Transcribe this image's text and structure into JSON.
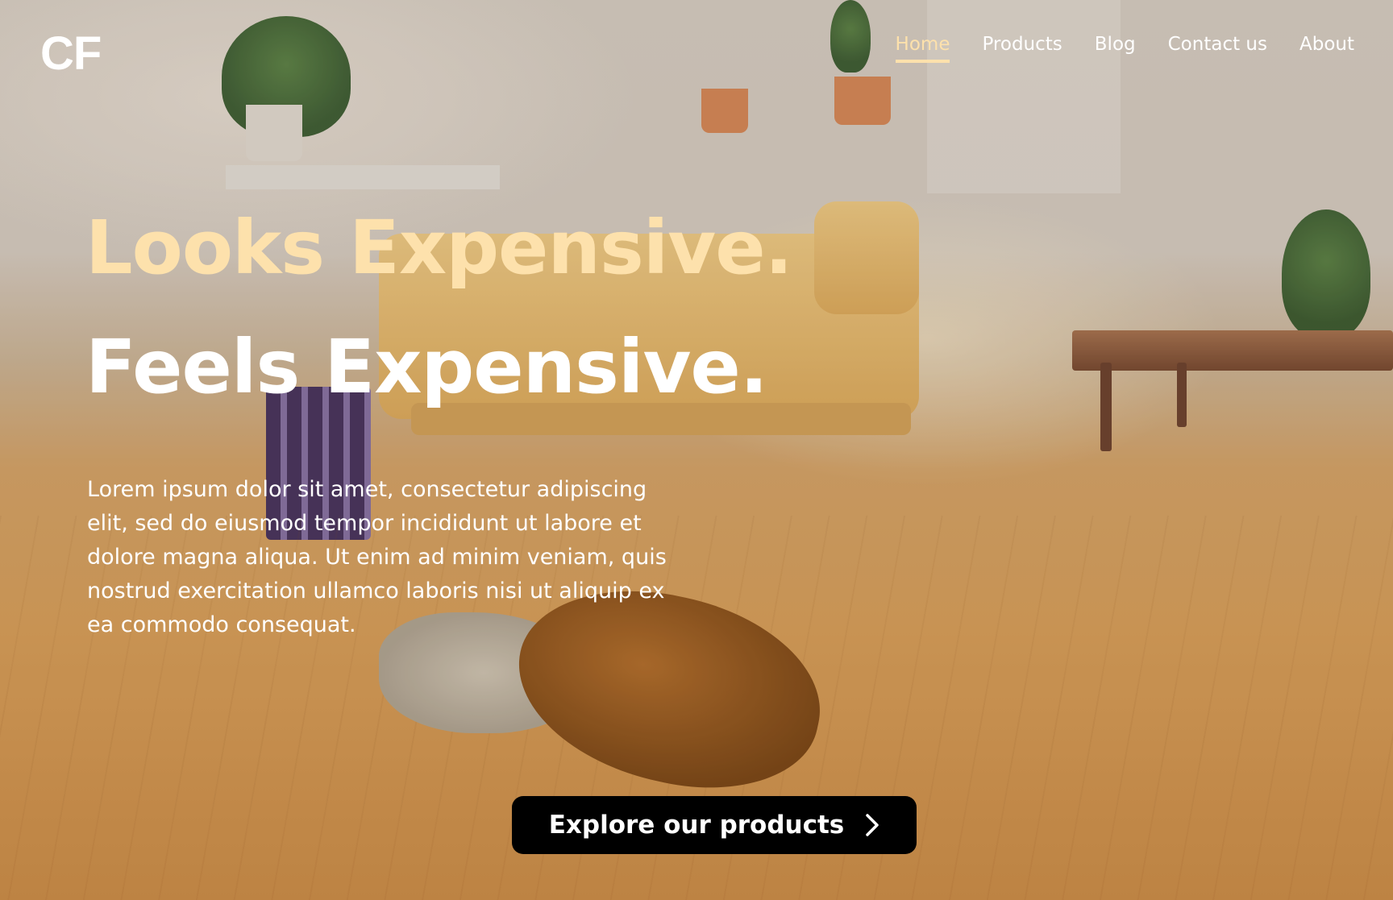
{
  "brand": {
    "logo_text": "CF"
  },
  "nav": {
    "items": [
      {
        "label": "Home",
        "active": true
      },
      {
        "label": "Products",
        "active": false
      },
      {
        "label": "Blog",
        "active": false
      },
      {
        "label": "Contact us",
        "active": false
      },
      {
        "label": "About",
        "active": false
      }
    ]
  },
  "hero": {
    "headline_1": "Looks Expensive.",
    "headline_2": "Feels Expensive.",
    "description": "Lorem ipsum dolor sit amet, consectetur adipiscing elit, sed do eiusmod tempor incididunt ut labore et dolore magna aliqua. Ut enim ad minim veniam, quis nostrud exercitation ullamco laboris nisi ut aliquip ex ea commodo consequat.",
    "cta_label": "Explore our products",
    "cta_icon": "chevron-right-icon"
  },
  "colors": {
    "accent": "#fde1ac",
    "text": "#ffffff",
    "button_bg": "#000000"
  }
}
